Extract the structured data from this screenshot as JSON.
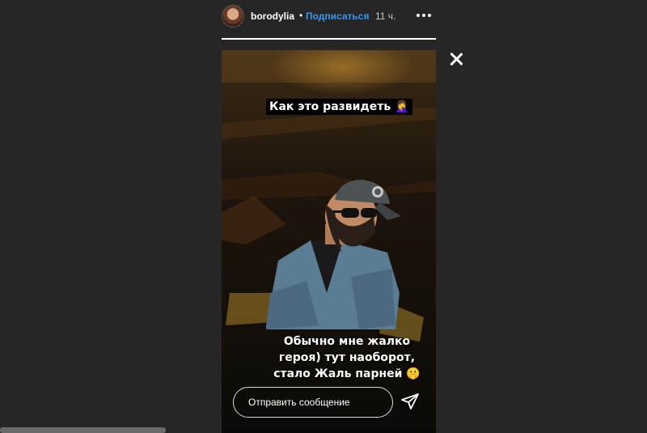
{
  "header": {
    "username": "borodylia",
    "separator": "•",
    "follow_label": "Подписаться",
    "time": "11 ч.",
    "more_icon": "more-horizontal-icon"
  },
  "story": {
    "progress": 1.0,
    "caption_top": "Как это развидеть 🤦‍♀️",
    "caption_bottom": [
      "Обычно мне жалко",
      "героя) тут наоборот,",
      "стало   Жаль парней 🤫"
    ],
    "message_placeholder": "Отправить сообщение",
    "send_icon": "paper-plane-icon",
    "close_icon": "close-icon"
  },
  "colors": {
    "background": "#262626",
    "accent": "#3797f0"
  }
}
